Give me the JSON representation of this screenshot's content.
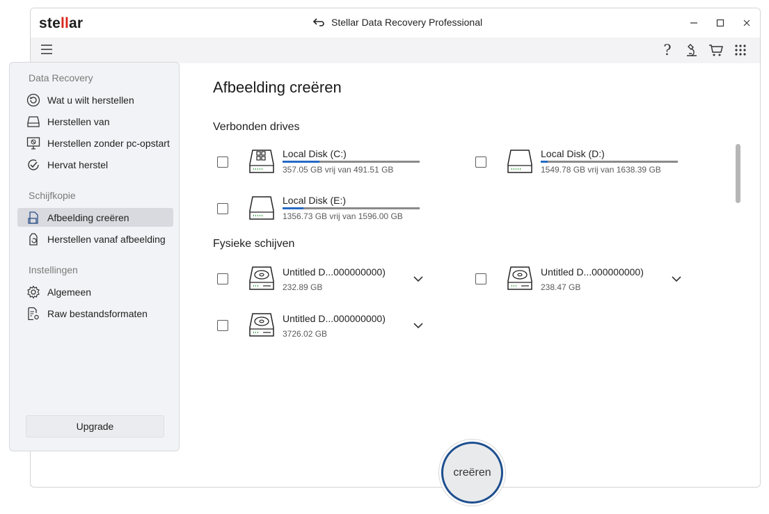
{
  "app": {
    "logo_text_a": "ste",
    "logo_text_b": "ll",
    "logo_text_c": "ar",
    "title": "Stellar Data Recovery Professional",
    "accent_color": "#2469c5",
    "brand_color": "#d9261c"
  },
  "sidebar": {
    "sections": [
      {
        "label": "Data Recovery",
        "items": [
          {
            "label": "Wat u wilt herstellen",
            "icon": "restore-circle-icon"
          },
          {
            "label": "Herstellen van",
            "icon": "drive-icon"
          },
          {
            "label": "Herstellen zonder pc-opstart",
            "icon": "monitor-icon"
          },
          {
            "label": "Hervat herstel",
            "icon": "resume-check-icon"
          }
        ]
      },
      {
        "label": "Schijfkopie",
        "items": [
          {
            "label": "Afbeelding creëren",
            "icon": "create-image-icon",
            "active": true
          },
          {
            "label": "Herstellen vanaf afbeelding",
            "icon": "restore-image-icon"
          }
        ]
      },
      {
        "label": "Instellingen",
        "items": [
          {
            "label": "Algemeen",
            "icon": "gear-icon"
          },
          {
            "label": "Raw bestandsformaten",
            "icon": "file-settings-icon"
          }
        ]
      }
    ],
    "upgrade_label": "Upgrade"
  },
  "main": {
    "title": "Afbeelding creëren",
    "connected_title": "Verbonden drives",
    "physical_title": "Fysieke schijven",
    "connected_drives": [
      {
        "name": "Local Disk (C:)",
        "info": "357.05 GB vrij van 491.51 GB",
        "used_fraction": 0.27
      },
      {
        "name": "Local Disk (D:)",
        "info": "1549.78 GB vrij van 1638.39 GB",
        "used_fraction": 0.05
      },
      {
        "name": "Local Disk (E:)",
        "info": "1356.73 GB vrij van 1596.00 GB",
        "used_fraction": 0.15
      }
    ],
    "physical_disks": [
      {
        "name": "Untitled D...000000000)",
        "size": "232.89 GB"
      },
      {
        "name": "Untitled D...000000000)",
        "size": "238.47 GB"
      },
      {
        "name": "Untitled D...000000000)",
        "size": "3726.02 GB"
      }
    ],
    "create_label": "creëren"
  }
}
